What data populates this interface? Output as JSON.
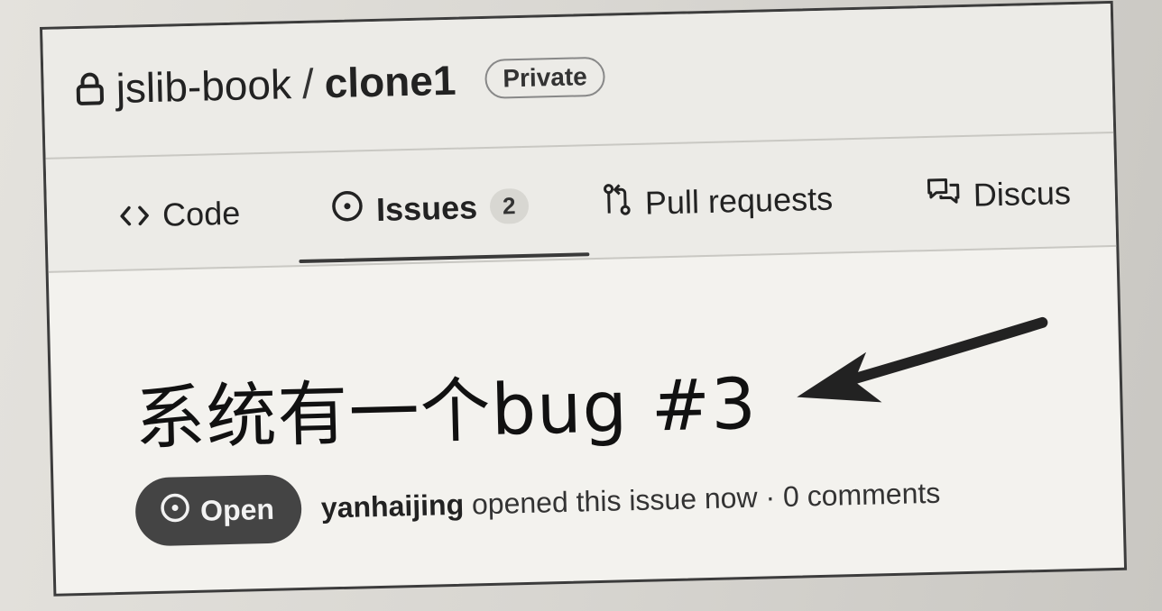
{
  "repo": {
    "owner": "jslib-book",
    "separator": "/",
    "name": "clone1",
    "visibility": "Private"
  },
  "tabs": [
    {
      "label": "Code",
      "icon": "code-icon"
    },
    {
      "label": "Issues",
      "icon": "issue-opened-icon",
      "count": "2",
      "selected": true
    },
    {
      "label": "Pull requests",
      "icon": "git-pull-request-icon"
    },
    {
      "label": "Discus",
      "icon": "discussions-icon"
    }
  ],
  "issue": {
    "title": "系统有一个bug #3",
    "state": "Open",
    "author": "yanhaijing",
    "opened_text": "opened this issue now · 0 comments"
  },
  "colors": {
    "state_badge_bg": "#444444",
    "arrow": "#222222"
  }
}
